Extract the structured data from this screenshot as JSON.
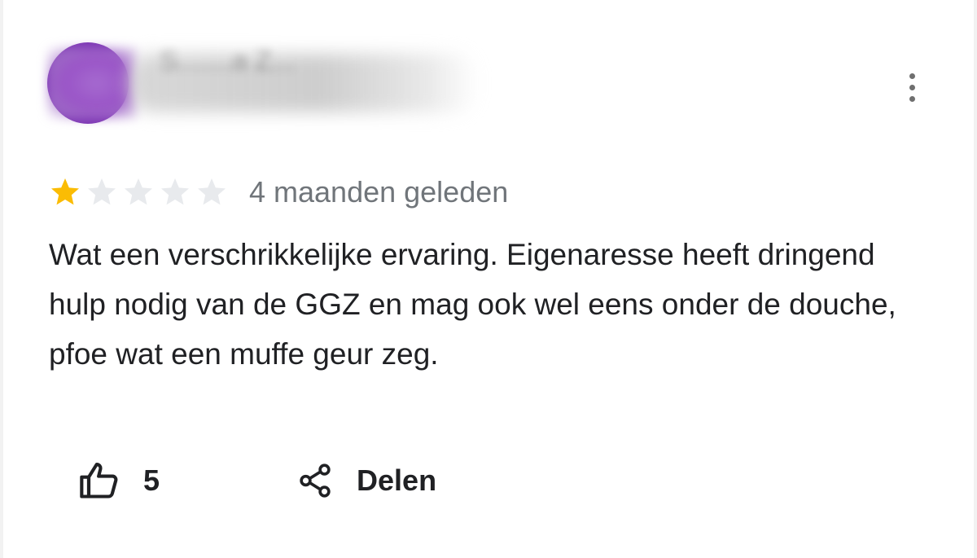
{
  "review": {
    "reviewer_name": "S.......a  Z...",
    "rating": 1,
    "rating_max": 5,
    "timestamp": "4 maanden geleden",
    "text": "Wat een verschrikkelijke ervaring. Eigenaresse heeft dringend hulp nodig van de GGZ en mag ook wel eens onder de douche, pfoe wat een muffe geur zeg."
  },
  "actions": {
    "like_count": "5",
    "share_label": "Delen"
  },
  "icons": {
    "star_filled": "star-icon",
    "star_empty": "star-outline-icon",
    "like": "thumbs-up-icon",
    "share": "share-icon",
    "more": "more-vertical-icon"
  },
  "colors": {
    "avatar": "#7b33b3",
    "star_filled": "#fbbc04",
    "star_empty": "#e8eaed",
    "timestamp": "#70757a",
    "text": "#202124"
  }
}
